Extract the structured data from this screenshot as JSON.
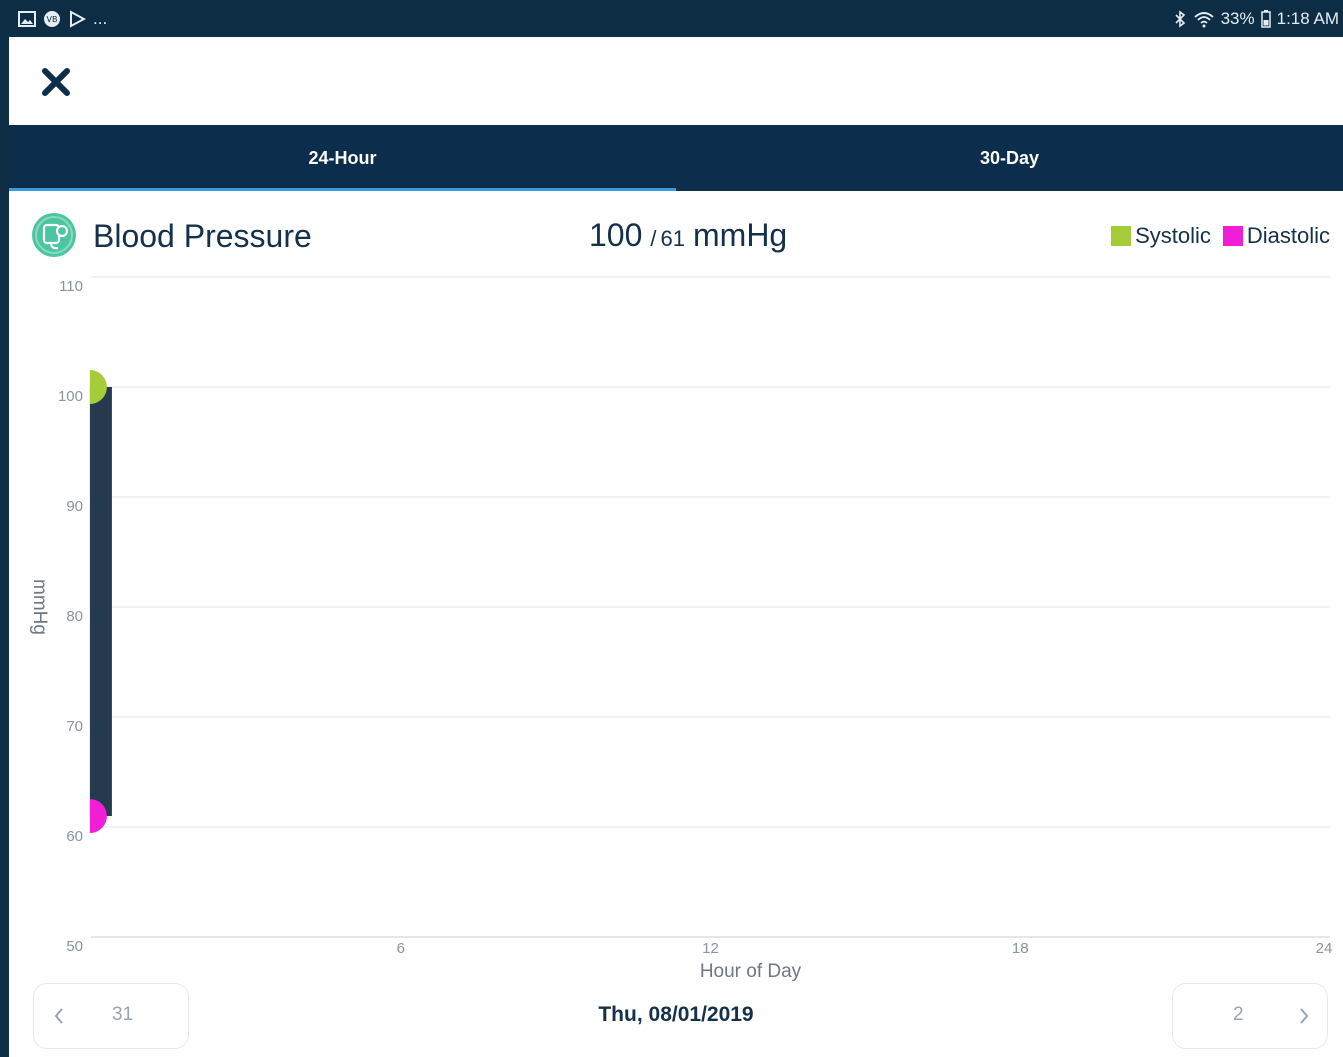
{
  "status_bar": {
    "dots": "...",
    "battery": "33%",
    "time": "1:18 AM",
    "icons": [
      "gallery-icon",
      "vpn-icon",
      "play-store-icon",
      "bluetooth-icon",
      "wifi-icon",
      "battery-icon"
    ]
  },
  "toolbar": {
    "close_icon": "close-icon"
  },
  "tabs": [
    {
      "label": "24-Hour",
      "active": true
    },
    {
      "label": "30-Day",
      "active": false
    }
  ],
  "header": {
    "title": "Blood Pressure",
    "icon": "blood-pressure-icon",
    "icon_color": "#4cc5a0",
    "systolic": "100",
    "separator": "/",
    "diastolic": "61",
    "unit": "mmHg"
  },
  "legend": [
    {
      "label": "Systolic",
      "color": "#a6cd39"
    },
    {
      "label": "Diastolic",
      "color": "#f01fd7"
    }
  ],
  "chart_data": {
    "type": "bar",
    "ylabel": "mmHg",
    "xlabel": "Hour of Day",
    "ylim": [
      50,
      110
    ],
    "yticks": [
      110,
      100,
      90,
      80,
      70,
      60,
      50
    ],
    "xlim": [
      0,
      24
    ],
    "xticks": [
      6,
      12,
      18,
      24
    ],
    "grid": true,
    "readings": [
      {
        "hour": 0.25,
        "systolic": 100,
        "diastolic": 61
      }
    ],
    "bar_color": "#25394f",
    "systolic_color": "#a6cd39",
    "diastolic_color": "#f01fd7"
  },
  "date_nav": {
    "prev_label": "31",
    "current": "Thu, 08/01/2019",
    "next_label": "2"
  }
}
